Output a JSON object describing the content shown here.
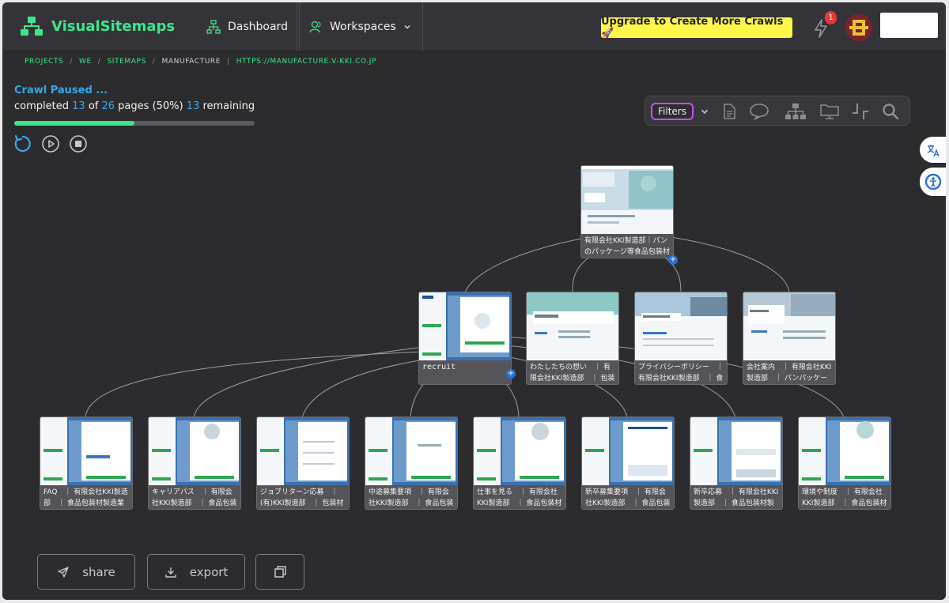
{
  "app": {
    "name": "VisualSitemaps"
  },
  "nav": {
    "dashboard": "Dashboard",
    "workspaces": "Workspaces"
  },
  "upgrade": {
    "label": "Upgrade to Create More Crawls 🚀"
  },
  "notifications": {
    "count": "1"
  },
  "breadcrumb": [
    "PROJECTS",
    "WE",
    "SITEMAPS",
    "MANUFACTURE",
    "HTTPS://MANUFACTURE.V-KKI.CO.JP"
  ],
  "crawl": {
    "title": "Crawl Paused ...",
    "prefix": "completed",
    "completed": "13",
    "of": "of",
    "total": "26",
    "pages_label": "pages",
    "percent": "(50%)",
    "remaining": "13",
    "remaining_label": "remaining",
    "progress": 0.5
  },
  "filters": {
    "label": "Filters"
  },
  "nodes": {
    "root": "有限会社KKI製造部｜パンのパッケージ等食品包装材",
    "recruit": "recruit",
    "l2_1": "わたしたちの想い　｜ 有限会社KKI製造部　｜ 包装資材",
    "l2_2": "プライバシーポリシー　｜ 有限会社KKI製造部　｜ 食品包装",
    "l2_3": "会社案内　｜ 有限会社KKI製造部　｜ パンパッケージ",
    "l3_1": "FAQ　｜ 有限会社KKI製造部　｜ 食品包装材製造業",
    "l3_2": "キャリアパス　｜ 有限会社KKI製造部　｜ 食品包装材製造業",
    "l3_3": "ジョブリターン応募　｜ (有)KKI製造部　｜ 包装材製造業",
    "l3_4": "中途募集要項　｜ 有限会社KKI製造部　｜ 食品包装材製造業",
    "l3_5": "仕事を見る　｜ 有限会社KKI製造部　｜ 食品包装材製造業",
    "l3_6": "新卒募集要項　｜ 有限会社KKI製造部　｜ 食品包装材",
    "l3_7": "新卒応募　｜ 有限会社KKI製造部　｜ 食品包装材製造",
    "l3_8": "環境や制度　｜ 有限会社KKI製造部　｜ 食品包装材製造業"
  },
  "actions": {
    "share": "share",
    "export": "export"
  },
  "icons": [
    "sitemap-logo-icon",
    "sitemap-icon",
    "users-icon",
    "chevron-down-icon",
    "bolt-icon",
    "restart-icon",
    "play-icon",
    "stop-icon",
    "document-icon",
    "comment-icon",
    "hierarchy-icon",
    "monitor-icon",
    "crop-icon",
    "search-icon",
    "translate-icon",
    "accessibility-icon",
    "send-icon",
    "download-icon",
    "copy-icon"
  ],
  "colors": {
    "accent_green": "#3ee58a",
    "accent_blue": "#36a8e8",
    "upgrade_yellow": "#fff64a",
    "filters_outline": "#c450f0"
  }
}
